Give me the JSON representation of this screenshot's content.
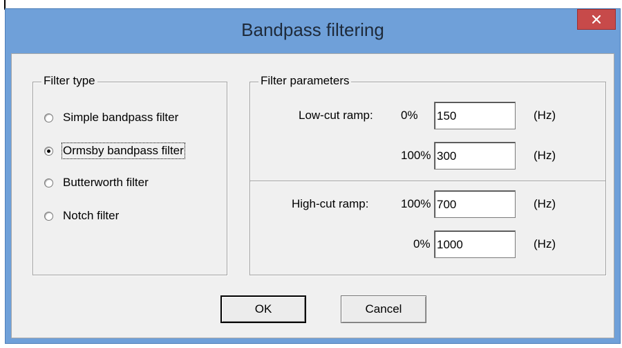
{
  "window": {
    "title": "Bandpass filtering",
    "close_symbol": "×"
  },
  "filter_type": {
    "group_label": "Filter type",
    "options": [
      {
        "label": "Simple bandpass filter",
        "checked": false
      },
      {
        "label": "Ormsby bandpass filter",
        "checked": true
      },
      {
        "label": "Butterworth filter",
        "checked": false
      },
      {
        "label": "Notch filter",
        "checked": false
      }
    ]
  },
  "filter_parameters": {
    "group_label": "Filter parameters",
    "low_cut": {
      "label": "Low-cut ramp:",
      "row_0": {
        "percent": "0%",
        "value": "150",
        "unit": "(Hz)"
      },
      "row_100": {
        "percent": "100%",
        "value": "300",
        "unit": "(Hz)"
      }
    },
    "high_cut": {
      "label": "High-cut ramp:",
      "row_100": {
        "percent": "100%",
        "value": "700",
        "unit": "(Hz)"
      },
      "row_0": {
        "percent": "0%",
        "value": "1000",
        "unit": "(Hz)"
      }
    }
  },
  "buttons": {
    "ok_label": "OK",
    "cancel_label": "Cancel"
  },
  "colors": {
    "title_bar": "#6fa0d9",
    "close_button": "#c74a4a",
    "dialog_bg": "#f0f0f0"
  }
}
